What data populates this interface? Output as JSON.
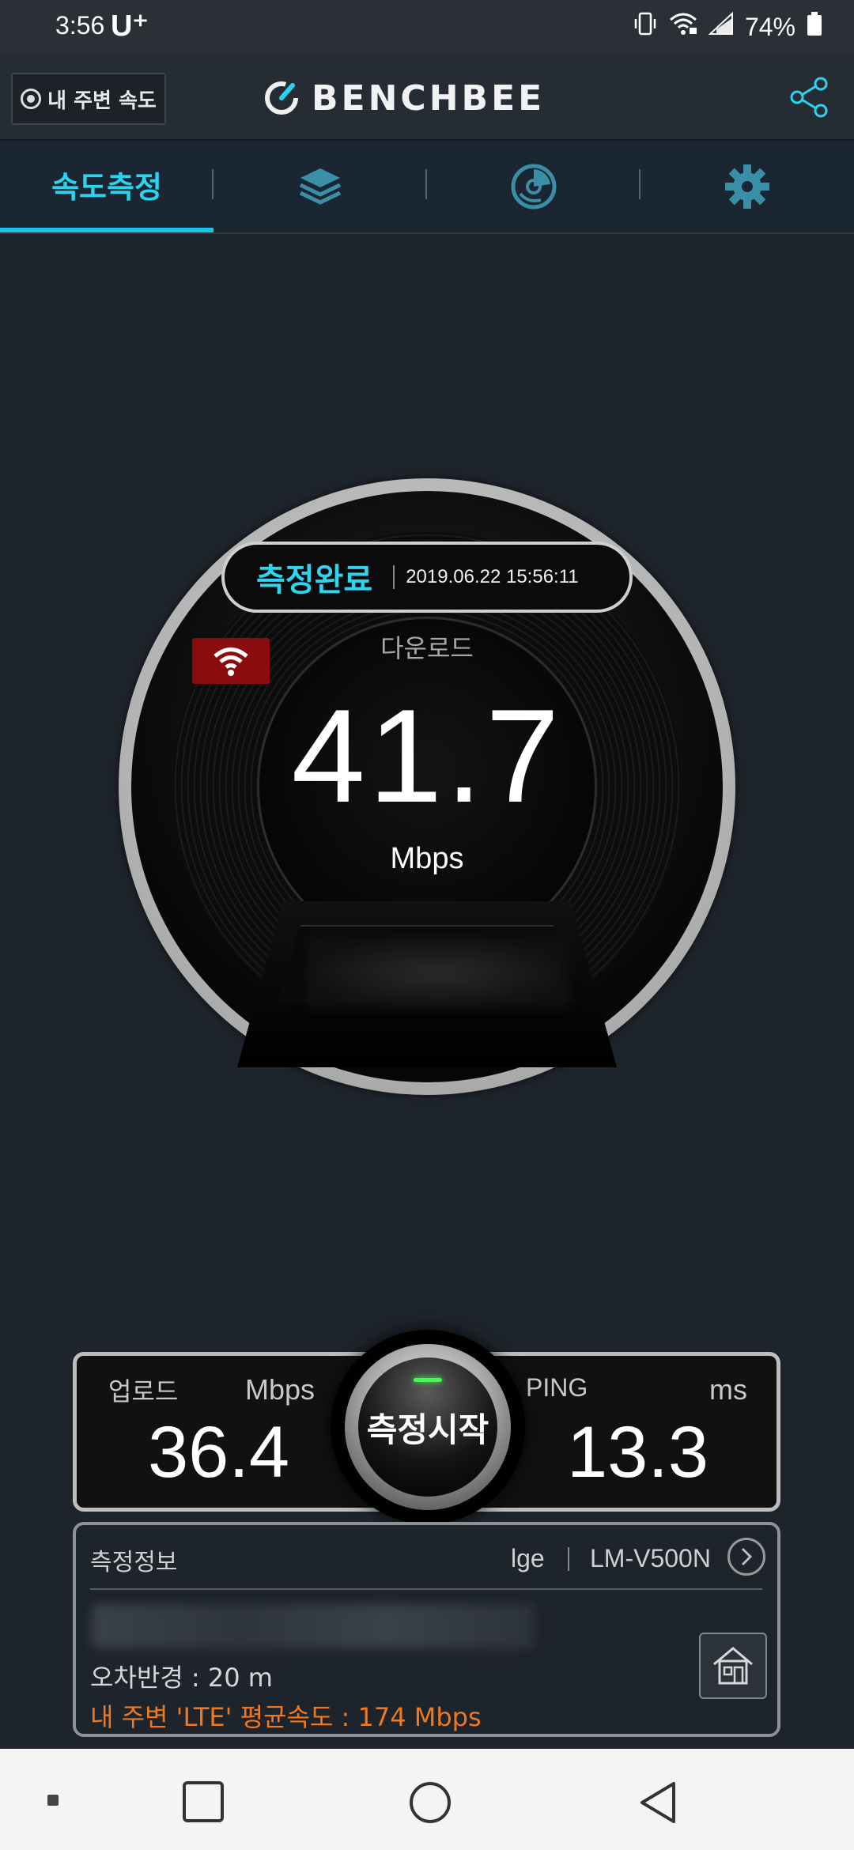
{
  "status_bar": {
    "time": "3:56",
    "carrier": "U⁺",
    "battery": "74%",
    "icons": [
      "vibrate-icon",
      "wifi-icon",
      "signal-icon",
      "battery-icon"
    ]
  },
  "header": {
    "nearby_button": "내 주변 속도",
    "logo": "BENCHBEE",
    "share_icon": "share-icon"
  },
  "tabs": [
    {
      "label": "속도측정",
      "active": true
    },
    {
      "icon": "layers-icon",
      "active": false
    },
    {
      "icon": "map-dial-icon",
      "active": false
    },
    {
      "icon": "gear-icon",
      "active": false
    }
  ],
  "gauge": {
    "status": "측정완료",
    "datetime": "2019.06.22 15:56:11",
    "connection_icon": "wifi-icon",
    "download_label": "다운로드",
    "download_value": "41.7",
    "download_unit": "Mbps"
  },
  "stats": {
    "upload_label": "업로드",
    "upload_unit": "Mbps",
    "upload_value": "36.4",
    "start_button": "측정시작",
    "ping_label": "PING",
    "ping_unit": "ms",
    "ping_value": "13.3"
  },
  "info": {
    "title": "측정정보",
    "brand": "lge",
    "model": "LM-V500N",
    "error_radius": "오차반경 : 20 m",
    "nearby_avg": "내 주변 'LTE' 평균속도 :  174 Mbps"
  },
  "colors": {
    "accent": "#2cd3ef",
    "background": "#1e242b",
    "orange": "#f0781e",
    "wifi_badge": "#8b0c0c"
  }
}
